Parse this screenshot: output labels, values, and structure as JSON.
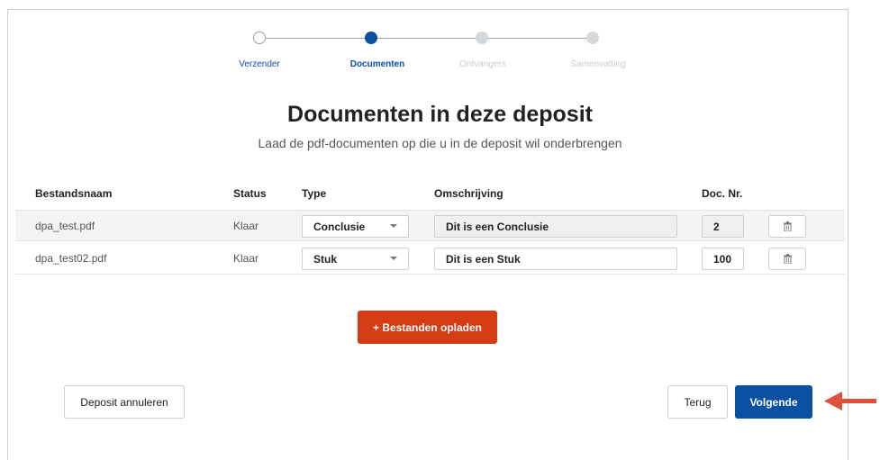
{
  "stepper": {
    "steps": [
      {
        "label": "Verzender",
        "state": "done"
      },
      {
        "label": "Documenten",
        "state": "active"
      },
      {
        "label": "Ontvangers",
        "state": "future"
      },
      {
        "label": "Samenvatting",
        "state": "future"
      }
    ]
  },
  "page": {
    "title": "Documenten in deze deposit",
    "subtitle": "Laad de pdf-documenten op die u in de deposit wil onderbrengen"
  },
  "table": {
    "headers": {
      "filename": "Bestandsnaam",
      "status": "Status",
      "type": "Type",
      "description": "Omschrijving",
      "doc_nr": "Doc. Nr."
    },
    "rows": [
      {
        "filename": "dpa_test.pdf",
        "status": "Klaar",
        "type": "Conclusie",
        "description": "Dit is een Conclusie",
        "doc_nr": "2"
      },
      {
        "filename": "dpa_test02.pdf",
        "status": "Klaar",
        "type": "Stuk",
        "description": "Dit is een Stuk",
        "doc_nr": "100"
      }
    ]
  },
  "buttons": {
    "upload": "+ Bestanden opladen",
    "cancel": "Deposit annuleren",
    "back": "Terug",
    "next": "Volgende"
  },
  "colors": {
    "primary": "#0b4fa1",
    "upload": "#d63c14",
    "arrow": "#e0503a"
  },
  "icons": {
    "row_action": "trash-icon",
    "annotation": "arrow-left-icon"
  }
}
